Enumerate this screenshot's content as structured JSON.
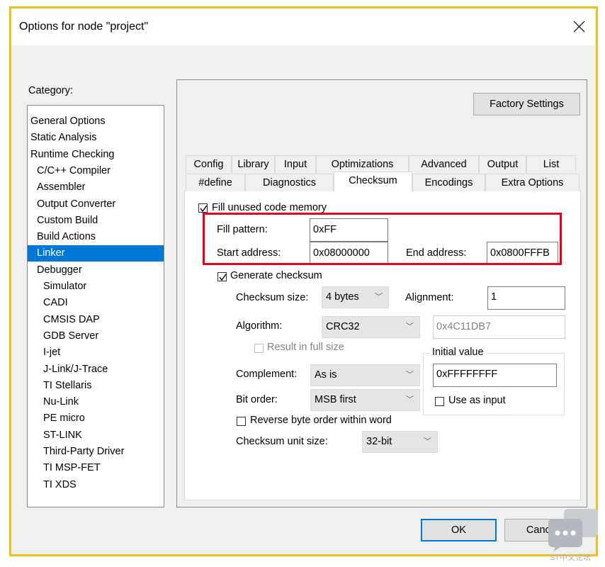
{
  "window": {
    "title": "Options for node \"project\""
  },
  "category": {
    "label": "Category:",
    "items": [
      {
        "label": "General Options",
        "level": 0
      },
      {
        "label": "Static Analysis",
        "level": 0
      },
      {
        "label": "Runtime Checking",
        "level": 0
      },
      {
        "label": "C/C++ Compiler",
        "level": 1
      },
      {
        "label": "Assembler",
        "level": 1
      },
      {
        "label": "Output Converter",
        "level": 1
      },
      {
        "label": "Custom Build",
        "level": 1
      },
      {
        "label": "Build Actions",
        "level": 1
      },
      {
        "label": "Linker",
        "level": 1,
        "selected": true
      },
      {
        "label": "Debugger",
        "level": 1
      },
      {
        "label": "Simulator",
        "level": 2
      },
      {
        "label": "CADI",
        "level": 2
      },
      {
        "label": "CMSIS DAP",
        "level": 2
      },
      {
        "label": "GDB Server",
        "level": 2
      },
      {
        "label": "I-jet",
        "level": 2
      },
      {
        "label": "J-Link/J-Trace",
        "level": 2
      },
      {
        "label": "TI Stellaris",
        "level": 2
      },
      {
        "label": "Nu-Link",
        "level": 2
      },
      {
        "label": "PE micro",
        "level": 2
      },
      {
        "label": "ST-LINK",
        "level": 2
      },
      {
        "label": "Third-Party Driver",
        "level": 2
      },
      {
        "label": "TI MSP-FET",
        "level": 2
      },
      {
        "label": "TI XDS",
        "level": 2
      }
    ]
  },
  "factory_settings_label": "Factory Settings",
  "tabs": {
    "row1": [
      "Config",
      "Library",
      "Input",
      "Optimizations",
      "Advanced",
      "Output",
      "List"
    ],
    "row2": [
      "#define",
      "Diagnostics",
      "Checksum",
      "Encodings",
      "Extra Options"
    ],
    "active": "Checksum"
  },
  "checksum": {
    "fill_unused_label": "Fill unused code memory",
    "fill_unused_checked": true,
    "fill_pattern_label": "Fill pattern:",
    "fill_pattern_value": "0xFF",
    "start_address_label": "Start address:",
    "start_address_value": "0x08000000",
    "end_address_label": "End address:",
    "end_address_value": "0x0800FFFB",
    "generate_label": "Generate checksum",
    "generate_checked": true,
    "size_label": "Checksum size:",
    "size_value": "4 bytes",
    "alignment_label": "Alignment:",
    "alignment_value": "1",
    "algorithm_label": "Algorithm:",
    "algorithm_value": "CRC32",
    "polynomial_value": "0x4C11DB7",
    "result_full_label": "Result in full size",
    "result_full_checked": false,
    "initial_value_label": "Initial value",
    "initial_value": "0xFFFFFFFF",
    "use_as_input_label": "Use as input",
    "use_as_input_checked": false,
    "complement_label": "Complement:",
    "complement_value": "As is",
    "bit_order_label": "Bit order:",
    "bit_order_value": "MSB first",
    "reverse_label": "Reverse byte order within word",
    "reverse_checked": false,
    "unit_size_label": "Checksum unit size:",
    "unit_size_value": "32-bit"
  },
  "footer": {
    "ok_label": "OK",
    "cancel_label": "Cancel"
  },
  "watermark": {
    "text": "ST中文论坛"
  },
  "colors": {
    "frame": "#f2bf1a",
    "highlight": "#e5001b",
    "selection": "#0078d7"
  }
}
